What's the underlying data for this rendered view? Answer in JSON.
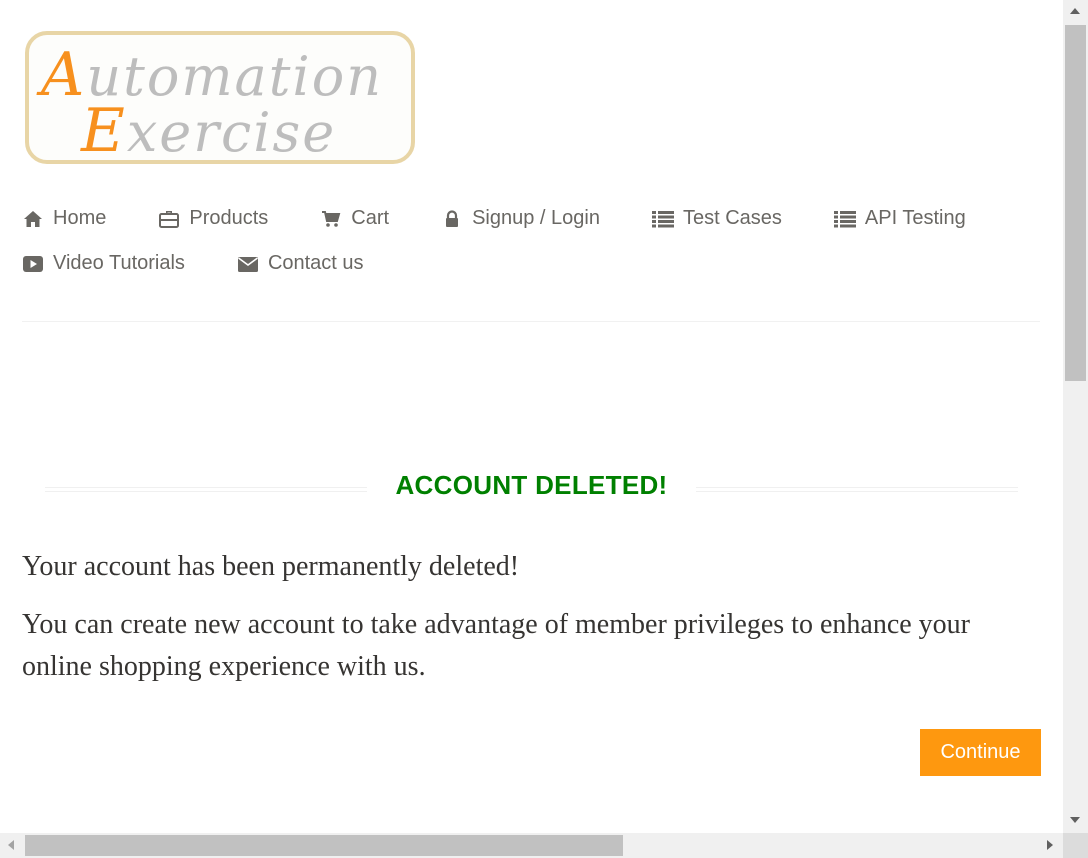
{
  "logo": {
    "line1_cap": "A",
    "line1_rest": "utomation",
    "line2_cap": "E",
    "line2_rest": "xercise"
  },
  "nav": {
    "items": [
      {
        "label": "Home",
        "icon": "home-icon"
      },
      {
        "label": "Products",
        "icon": "briefcase-icon"
      },
      {
        "label": "Cart",
        "icon": "cart-icon"
      },
      {
        "label": "Signup / Login",
        "icon": "lock-icon"
      },
      {
        "label": "Test Cases",
        "icon": "list-icon"
      },
      {
        "label": "API Testing",
        "icon": "list-icon"
      },
      {
        "label": "Video Tutorials",
        "icon": "youtube-play-icon"
      },
      {
        "label": "Contact us",
        "icon": "envelope-icon"
      }
    ]
  },
  "main": {
    "title": "ACCOUNT DELETED!",
    "message1": "Your account has been permanently deleted!",
    "message2": "You can create new account to take advantage of member privileges to enhance your online shopping experience with us.",
    "continue_label": "Continue"
  },
  "colors": {
    "brand_orange": "#fe980f",
    "title_green": "#008000",
    "nav_text": "#696763"
  }
}
